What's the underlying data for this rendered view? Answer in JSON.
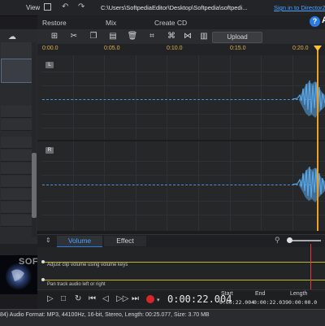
{
  "titlebar": {
    "view_label": "View",
    "path": "C:\\Users\\SoftpediaEditor\\Desktop\\Softpedia\\softpedi...",
    "signin_label": "Sign in to DirectorZon"
  },
  "mode_tabs": [
    "Restore",
    "Mix",
    "Create CD"
  ],
  "help_label": "?",
  "app_letter": "A",
  "toolbar": {
    "upload_label": "Upload",
    "icons": [
      "add-icon",
      "cut-icon",
      "copy-icon",
      "paste-icon",
      "delete-icon",
      "crop-icon",
      "link-icon",
      "split-icon",
      "settings-icon"
    ]
  },
  "timeline": {
    "ticks": [
      "0:00.0",
      "0:05.0",
      "0:10.0",
      "0:15.0",
      "0:20.0"
    ],
    "channels": [
      "L",
      "R"
    ]
  },
  "effect_tabs": {
    "volume": "Volume",
    "effect": "Effect"
  },
  "envelopes": {
    "volume_hint": "Adjust clip volume using volume keys",
    "pan_hint": "Pan track audio left or right"
  },
  "transport": {
    "current_time": "0:00:22.004",
    "start_label": "Start",
    "end_label": "End",
    "length_label": "Length",
    "start_value": "0:00:22.004",
    "end_value": "0:00:22.039",
    "length_value": "0:00:00.0"
  },
  "status": {
    "text": "84) Audio Format: MP3, 44100Hz, 16-bit, Stereo, Length: 00:25.077, Size: 3.70 MB"
  },
  "thumbnail_watermark": "SOFTPEDIA",
  "colors": {
    "accent": "#2a7be4",
    "playhead": "#f0a020",
    "waveform": "#5aa6e6",
    "record": "#d8262b"
  }
}
